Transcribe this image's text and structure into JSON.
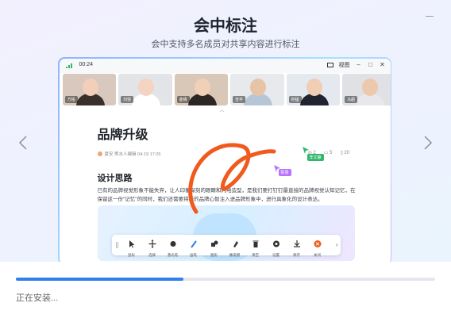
{
  "header": {
    "title": "会中标注",
    "subtitle": "会中支持多名成员对共享内容进行标注"
  },
  "preview": {
    "time": "00:24",
    "view_label": "视图",
    "participants": [
      {
        "name": "方铭",
        "bg": "#d9c8bd",
        "skin": "#f2cfb8",
        "cloth": "#3b2f2b"
      },
      {
        "name": "刘悦",
        "bg": "#e3e4e8",
        "skin": "#f3d4c2",
        "cloth": "#ffffff"
      },
      {
        "name": "金晴",
        "bg": "#d9c8b8",
        "skin": "#f1d0b8",
        "cloth": "#2c2624"
      },
      {
        "name": "吉平",
        "bg": "#e8e9ed",
        "skin": "#e8c4a6",
        "cloth": "#b7c6d6"
      },
      {
        "name": "孙猛",
        "bg": "#e4e8ef",
        "skin": "#f0cdb5",
        "cloth": "#1f2430"
      },
      {
        "name": "马超",
        "bg": "#dfe1e5",
        "skin": "#ecc8ac",
        "cloth": "#e8e8ea"
      }
    ],
    "doc": {
      "title": "品牌升级",
      "meta": "夏安  等水人编辑  04-19 17:26",
      "stats": [
        "2",
        "5",
        "20"
      ],
      "cursor_you": "李文静",
      "cursor_me": "陈慧",
      "heading": "设计思路",
      "paragraph": "已有的品牌视觉形象不能失弃，让人印象深刻的眼睛和闪电造型，是我们要打钉钉最直接的品牌视觉认知记忆，在保留这一份\"记忆\"的同时，我们还需要将新的品牌心智注入进品牌形象中，进行具象化的设计表达。"
    },
    "toolbar": [
      {
        "name": "pointer",
        "label": "鼠标"
      },
      {
        "name": "move",
        "label": "选择"
      },
      {
        "name": "laser",
        "label": "激光笔"
      },
      {
        "name": "pen",
        "label": "画笔"
      },
      {
        "name": "shape",
        "label": "图形"
      },
      {
        "name": "eraser",
        "label": "橡皮擦"
      },
      {
        "name": "clear",
        "label": "清空"
      },
      {
        "name": "settings",
        "label": "设置"
      },
      {
        "name": "save",
        "label": "保存"
      },
      {
        "name": "close",
        "label": "关闭"
      }
    ]
  },
  "progress": {
    "fraction": 0.4,
    "status": "正在安装..."
  },
  "colors": {
    "accent": "#2f80ed",
    "annotation": "#f05a1e"
  }
}
